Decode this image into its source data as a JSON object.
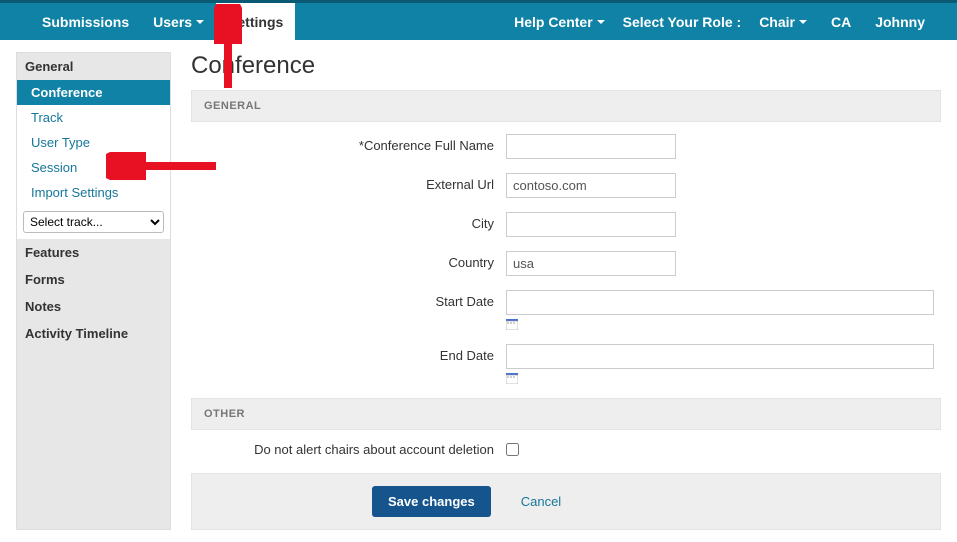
{
  "topnav": {
    "left": [
      "Submissions",
      "Users",
      "Settings"
    ],
    "help": "Help Center",
    "role_label": "Select Your Role :",
    "role_value": "Chair",
    "ca": "CA",
    "user": "Johnny"
  },
  "sidebar": {
    "general": "General",
    "items": [
      "Conference",
      "Track",
      "User Type",
      "Session",
      "Import Settings"
    ],
    "select_placeholder": "Select track...",
    "features": "Features",
    "forms": "Forms",
    "notes": "Notes",
    "timeline": "Activity Timeline"
  },
  "page": {
    "title": "Conference",
    "section_general": "GENERAL",
    "section_other": "OTHER",
    "labels": {
      "name": "Conference Full Name",
      "url": "External Url",
      "city": "City",
      "country": "Country",
      "start": "Start Date",
      "end": "End Date",
      "noalert": "Do not alert chairs about account deletion"
    },
    "values": {
      "name": "",
      "url": "contoso.com",
      "city": "",
      "country": "usa",
      "start": "",
      "end": ""
    },
    "actions": {
      "save": "Save changes",
      "cancel": "Cancel"
    }
  }
}
